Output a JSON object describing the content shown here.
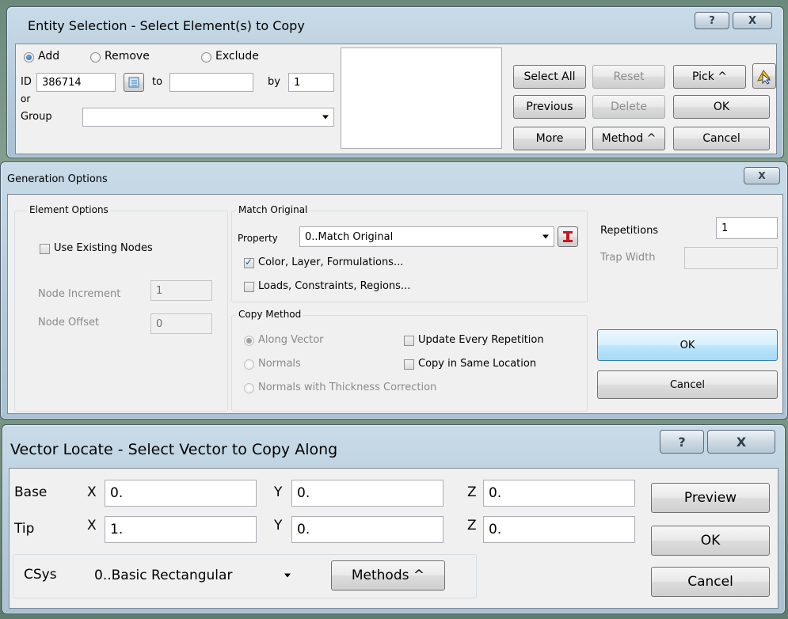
{
  "entity_selection": {
    "title": "Entity Selection - Select Element(s) to Copy",
    "help": "?",
    "close": "X",
    "radio_add": "Add",
    "radio_remove": "Remove",
    "radio_exclude": "Exclude",
    "id_label": "ID",
    "id_value": "386714",
    "to_label": "to",
    "to_value": "",
    "by_label": "by",
    "by_value": "1",
    "or_label": "or",
    "group_label": "Group",
    "group_value": "",
    "buttons": {
      "select_all": "Select All",
      "reset": "Reset",
      "pick": "Pick ^",
      "previous": "Previous",
      "delete": "Delete",
      "ok": "OK",
      "more": "More",
      "method": "Method ^",
      "cancel": "Cancel"
    }
  },
  "generation_options": {
    "title": "Generation Options",
    "close": "X",
    "element_options_title": "Element Options",
    "use_existing_nodes": "Use Existing Nodes",
    "node_increment_label": "Node Increment",
    "node_increment_value": "1",
    "node_offset_label": "Node Offset",
    "node_offset_value": "0",
    "match_original_title": "Match Original",
    "property_label": "Property",
    "property_value": "0..Match Original",
    "color_layer": "Color, Layer, Formulations...",
    "loads_constraints": "Loads, Constraints, Regions...",
    "copy_method_title": "Copy Method",
    "along_vector": "Along Vector",
    "normals": "Normals",
    "normals_thickness": "Normals with Thickness Correction",
    "update_every": "Update Every Repetition",
    "copy_same_location": "Copy in Same Location",
    "repetitions_label": "Repetitions",
    "repetitions_value": "1",
    "trap_width_label": "Trap Width",
    "trap_width_value": "",
    "ok": "OK",
    "cancel": "Cancel"
  },
  "vector_locate": {
    "title": "Vector Locate - Select Vector to Copy Along",
    "help": "?",
    "close": "X",
    "base_label": "Base",
    "tip_label": "Tip",
    "x_label": "X",
    "y_label": "Y",
    "z_label": "Z",
    "base_x": "0.",
    "base_y": "0.",
    "base_z": "0.",
    "tip_x": "1.",
    "tip_y": "0.",
    "tip_z": "0.",
    "csys_label": "CSys",
    "csys_value": "0..Basic Rectangular",
    "methods": "Methods ^",
    "preview": "Preview",
    "ok": "OK",
    "cancel": "Cancel"
  }
}
